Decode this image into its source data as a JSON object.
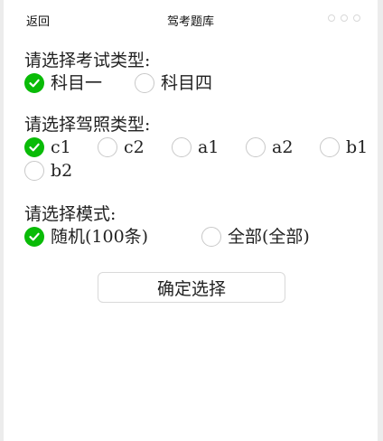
{
  "navbar": {
    "back_label": "返回",
    "title": "驾考题库",
    "menu_icon": "more-dots-icon"
  },
  "exam_type": {
    "label": "请选择考试类型:",
    "options": [
      {
        "label": "科目一",
        "checked": true
      },
      {
        "label": "科目四",
        "checked": false
      }
    ]
  },
  "license_type": {
    "label": "请选择驾照类型:",
    "options": [
      {
        "label": "c1",
        "checked": true
      },
      {
        "label": "c2",
        "checked": false
      },
      {
        "label": "a1",
        "checked": false
      },
      {
        "label": "a2",
        "checked": false
      },
      {
        "label": "b1",
        "checked": false
      },
      {
        "label": "b2",
        "checked": false
      }
    ]
  },
  "mode": {
    "label": "请选择模式:",
    "options": [
      {
        "label": "随机(100条)",
        "checked": true
      },
      {
        "label": "全部(全部)",
        "checked": false
      }
    ]
  },
  "confirm_label": "确定选择",
  "colors": {
    "checked": "#09bb07",
    "unchecked_border": "#c8c8c8"
  },
  "icons": {
    "checked": "checkmark-icon"
  }
}
